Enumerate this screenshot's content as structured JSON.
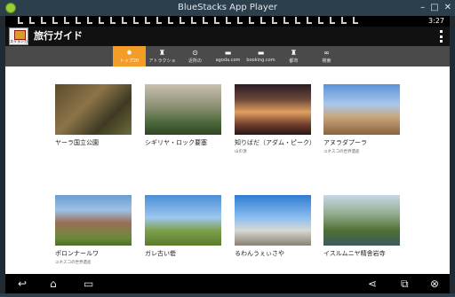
{
  "window": {
    "title": "BlueStacks App Player"
  },
  "status_bar": {
    "time": "3:27"
  },
  "app": {
    "title": "旅行ガイド",
    "logo_text": "スリランカ"
  },
  "tabs": [
    {
      "label": "トップ20",
      "icon": "compass-icon",
      "active": true
    },
    {
      "label": "アトラクショ",
      "icon": "person-icon",
      "active": false
    },
    {
      "label": "近所の",
      "icon": "location-icon",
      "active": false
    },
    {
      "label": "agoda.com",
      "icon": "bed-icon",
      "active": false
    },
    {
      "label": "booking.com",
      "icon": "bed-icon",
      "active": false
    },
    {
      "label": "都市",
      "icon": "person-icon",
      "active": false
    },
    {
      "label": "検索",
      "icon": "binoculars-icon",
      "active": false
    }
  ],
  "cards": [
    {
      "title": "ヤーラ国立公園",
      "subtitle": ""
    },
    {
      "title": "シギリヤ・ロック要塞",
      "subtitle": ""
    },
    {
      "title": "知りばだ（アダム・ピーク）",
      "subtitle": "山の頂"
    },
    {
      "title": "アヌラダプーラ",
      "subtitle": "ユネスコの世界遺産"
    },
    {
      "title": "ポロンナールワ",
      "subtitle": "ユネスコの世界遺産"
    },
    {
      "title": "ガレ古い砦",
      "subtitle": ""
    },
    {
      "title": "るわんうぇぃさや",
      "subtitle": ""
    },
    {
      "title": "イスルムニヤ精舎岩寺",
      "subtitle": ""
    }
  ],
  "colors": {
    "accent": "#f39c28",
    "tab_bar": "#4a4a4a",
    "app_bar": "#111111"
  }
}
